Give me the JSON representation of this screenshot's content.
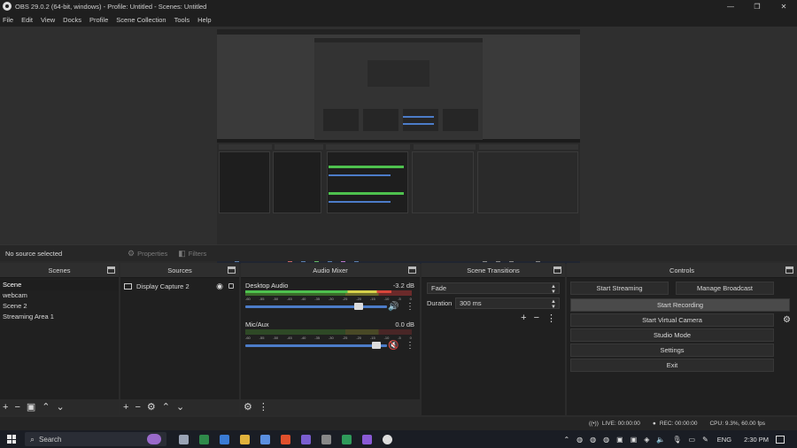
{
  "window": {
    "title": "OBS 29.0.2 (64-bit, windows) - Profile: Untitled - Scenes: Untitled"
  },
  "menu": [
    "File",
    "Edit",
    "View",
    "Docks",
    "Profile",
    "Scene Collection",
    "Tools",
    "Help"
  ],
  "source_bar": {
    "no_source": "No source selected",
    "properties": "Properties",
    "filters": "Filters"
  },
  "scenes": {
    "title": "Scenes",
    "items": [
      "Scene",
      "webcam",
      "Scene 2",
      "Streaming Area 1"
    ],
    "selected": "Scene"
  },
  "sources": {
    "title": "Sources",
    "items": [
      "Display Capture 2"
    ]
  },
  "mixer": {
    "title": "Audio Mixer",
    "channels": [
      {
        "name": "Desktop Audio",
        "db": "-3.2 dB",
        "volume": 0.82
      },
      {
        "name": "Mic/Aux",
        "db": "0.0 dB",
        "volume": 0.95
      }
    ],
    "ticks": [
      "-60",
      "-55",
      "-50",
      "-45",
      "-40",
      "-35",
      "-30",
      "-25",
      "-20",
      "-15",
      "-10",
      "-5",
      "0"
    ]
  },
  "transitions": {
    "title": "Scene Transitions",
    "type": "Fade",
    "duration_label": "Duration",
    "duration": "300 ms"
  },
  "controls": {
    "title": "Controls",
    "start_streaming": "Start Streaming",
    "manage_broadcast": "Manage Broadcast",
    "start_recording": "Start Recording",
    "start_virtual_camera": "Start Virtual Camera",
    "studio_mode": "Studio Mode",
    "settings": "Settings",
    "exit": "Exit"
  },
  "status": {
    "live": "LIVE: 00:00:00",
    "rec": "REC: 00:00:00",
    "cpu": "CPU: 9.3%, 60.00 fps"
  },
  "taskbar": {
    "search": "Search",
    "lang": "ENG",
    "time": "2:30 PM"
  },
  "colors": {
    "accent": "#4c7cc8",
    "meter_green": "#4ec14e",
    "meter_yellow": "#d6d14a",
    "meter_red": "#d9463a"
  }
}
